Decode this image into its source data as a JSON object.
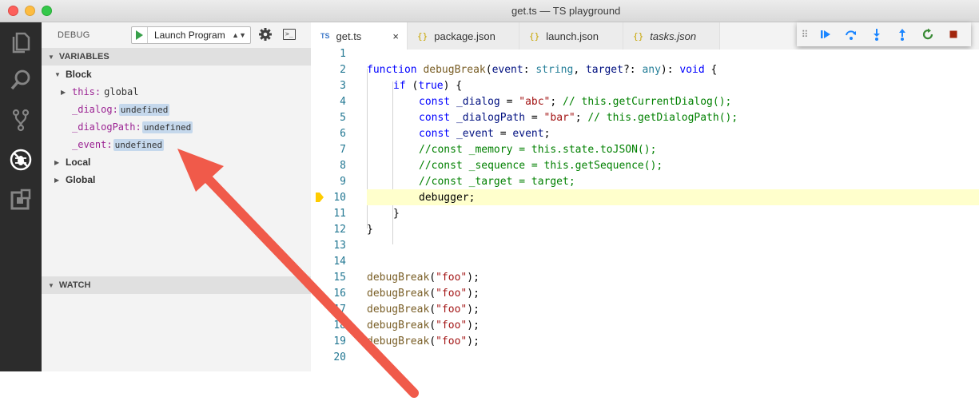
{
  "window": {
    "title": "get.ts — TS playground"
  },
  "activity_bar": {
    "items": [
      {
        "icon": "files-icon"
      },
      {
        "icon": "search-icon"
      },
      {
        "icon": "source-control-icon"
      },
      {
        "icon": "debug-icon"
      },
      {
        "icon": "extensions-icon"
      }
    ]
  },
  "debug": {
    "label": "DEBUG",
    "launch_config": "Launch Program"
  },
  "variables": {
    "header": "VARIABLES",
    "block_scope": "Block",
    "this_name": "this:",
    "this_value": "global",
    "vars": [
      {
        "name": "_dialog:",
        "value": "undefined"
      },
      {
        "name": "_dialogPath:",
        "value": "undefined"
      },
      {
        "name": "_event:",
        "value": "undefined"
      }
    ],
    "local_scope": "Local",
    "global_scope": "Global"
  },
  "watch": {
    "header": "WATCH"
  },
  "tabs": [
    {
      "icon_text": "TS",
      "label": "get.ts",
      "close": "×"
    },
    {
      "icon_text": "{}",
      "label": "package.json"
    },
    {
      "icon_text": "{}",
      "label": "launch.json"
    },
    {
      "icon_text": "{}",
      "label": "tasks.json"
    }
  ],
  "debug_toolbar": {
    "grip": "⠿",
    "buttons": [
      "continue-icon",
      "step-over-icon",
      "step-into-icon",
      "step-out-icon",
      "restart-icon",
      "stop-icon"
    ]
  },
  "editor": {
    "current_line": 10,
    "line_numbers": [
      "1",
      "2",
      "3",
      "4",
      "5",
      "6",
      "7",
      "8",
      "9",
      "10",
      "11",
      "12",
      "13",
      "14",
      "15",
      "16",
      "17",
      "18",
      "19",
      "20"
    ],
    "code": {
      "l2": [
        "function",
        " ",
        "debugBreak",
        "(",
        "event",
        ": ",
        "string",
        ", ",
        "target",
        "?: ",
        "any",
        "): ",
        "void",
        " {"
      ],
      "l3": [
        "if",
        " (",
        "true",
        ") {"
      ],
      "l4": [
        "const",
        " ",
        "_dialog",
        " = ",
        "\"abc\"",
        "; ",
        "// this.getCurrentDialog();"
      ],
      "l5": [
        "const",
        " ",
        "_dialogPath",
        " = ",
        "\"bar\"",
        "; ",
        "// this.getDialogPath();"
      ],
      "l6": [
        "const",
        " ",
        "_event",
        " = ",
        "event",
        ";"
      ],
      "l7": "//const _memory = this.state.toJSON();",
      "l8": "//const _sequence = this.getSequence();",
      "l9": "//const _target = target;",
      "l10": "debugger;",
      "l11": "}",
      "l12": "}",
      "call": [
        "debugBreak",
        "(",
        "\"foo\"",
        ");"
      ]
    }
  },
  "colors": {
    "activity_bg": "#2c2c2c",
    "sidebar_bg": "#f3f3f3",
    "current_line": "#ffffcc",
    "breakpoint": "#ffcc00",
    "arrow": "#f05a4a"
  }
}
